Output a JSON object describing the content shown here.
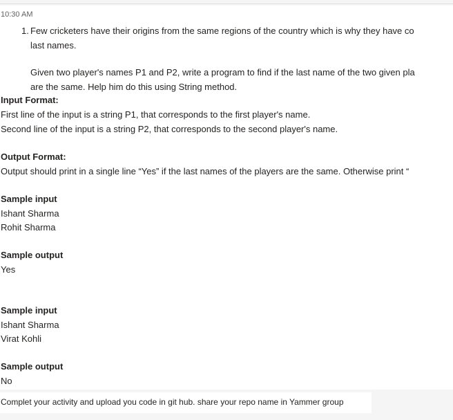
{
  "message": {
    "timestamp": "10:30 AM",
    "list_number": "1.",
    "intro_line1": "Few cricketers have their origins from the same regions of the country which is why they have co",
    "intro_line2": "last names.",
    "task_line1": "Given two player's names P1 and P2, write a program to find if the last name of the two given pla",
    "task_line2": "are the same. Help him do this using String method.",
    "input_format_heading": "Input Format:",
    "input_format_line1": "First line of the input is a string P1, that corresponds to the first player's name.",
    "input_format_line2": "Second line of the input is a string P2, that corresponds to the second player's name.",
    "output_format_heading": "Output Format:",
    "output_format_line1": "Output should print in a single line “Yes” if the last names of the players are the same. Otherwise print “",
    "sample1_input_heading": "Sample input",
    "sample1_input_line1": "Ishant Sharma",
    "sample1_input_line2": "Rohit Sharma",
    "sample1_output_heading": "Sample output",
    "sample1_output_value": "Yes",
    "sample2_input_heading": "Sample input",
    "sample2_input_line1": "Ishant Sharma",
    "sample2_input_line2": "Virat Kohli",
    "sample2_output_heading": "Sample output",
    "sample2_output_value": "No"
  },
  "footer": {
    "text": "Complet your activity and upload you code in git hub. share your repo name in Yammer group"
  }
}
